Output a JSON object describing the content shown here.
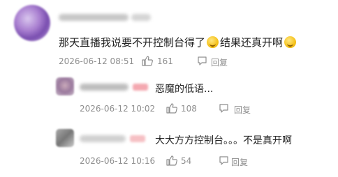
{
  "main_comment": {
    "text_before_emoji": "那天直播我说要不开控制台得了",
    "text_after_emoji": "结果还真开啊",
    "emoji_icon": "laughing-tears-emoji",
    "timestamp": "2026-06-12 08:51",
    "likes": "161",
    "reply_label": "回复"
  },
  "replies": [
    {
      "text": "恶魔的低语...",
      "timestamp": "2026-06-12 10:02",
      "likes": "108",
      "reply_label": "回复"
    },
    {
      "text": "大大方方控制台。。。不是真开啊",
      "timestamp": "2026-06-12 10:16",
      "likes": "54",
      "reply_label": "回复"
    }
  ],
  "colors": {
    "text": "#222222",
    "meta": "#8e8e8e",
    "badge": "#f4a8b0"
  }
}
